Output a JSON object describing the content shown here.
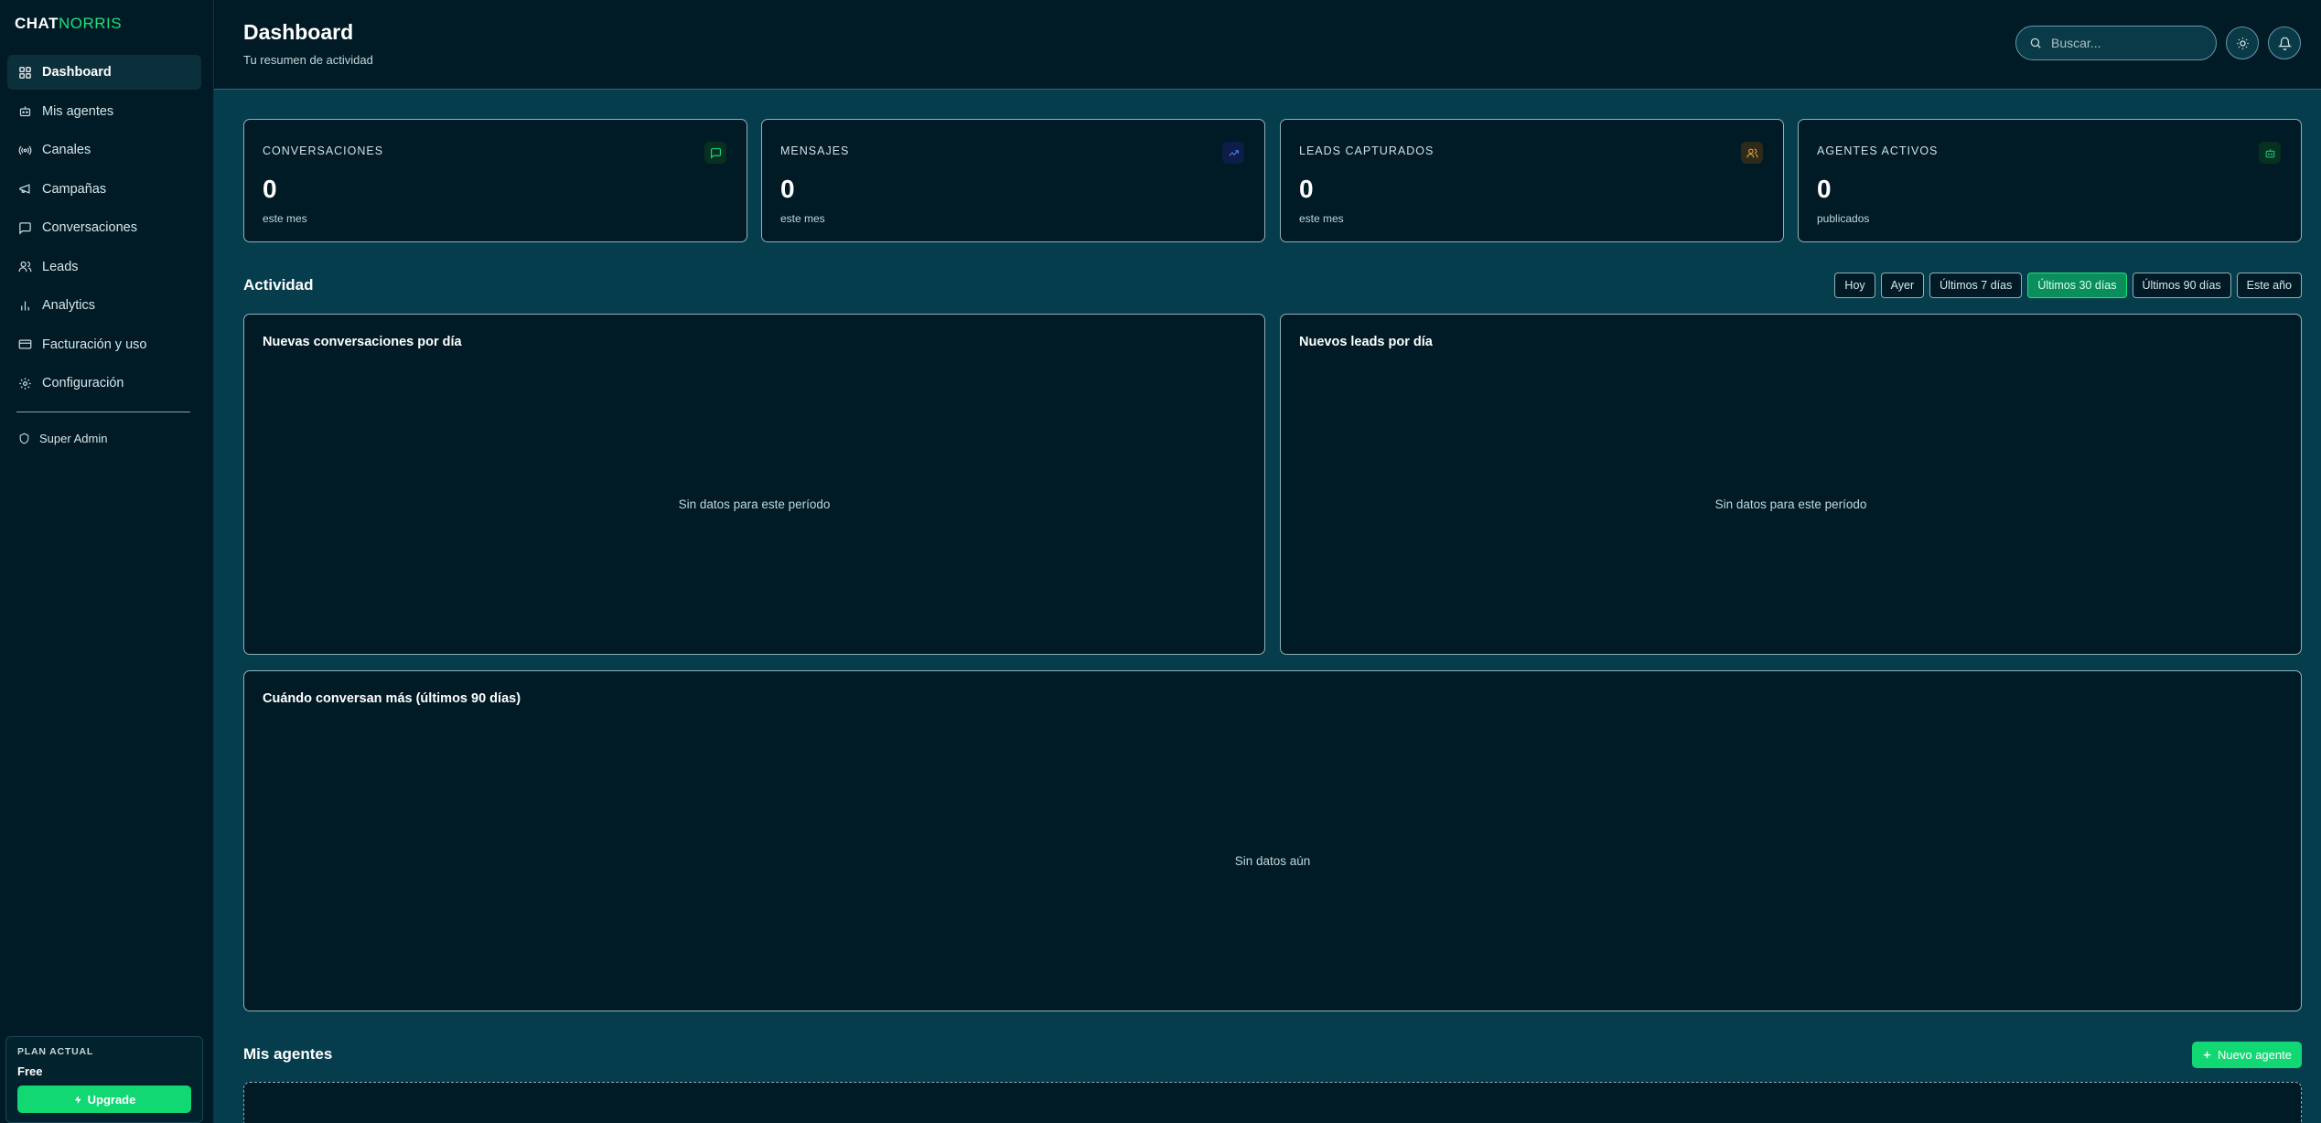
{
  "brand": {
    "part1": "CHAT",
    "part2": "NORRIS"
  },
  "sidebar": {
    "items": [
      {
        "label": "Dashboard",
        "icon": "grid-icon",
        "active": true
      },
      {
        "label": "Mis agentes",
        "icon": "bot-icon"
      },
      {
        "label": "Canales",
        "icon": "radio-icon"
      },
      {
        "label": "Campañas",
        "icon": "megaphone-icon"
      },
      {
        "label": "Conversaciones",
        "icon": "message-square-icon"
      },
      {
        "label": "Leads",
        "icon": "users-icon"
      },
      {
        "label": "Analytics",
        "icon": "bar-chart-icon"
      },
      {
        "label": "Facturación y uso",
        "icon": "credit-card-icon"
      },
      {
        "label": "Configuración",
        "icon": "gear-icon"
      }
    ],
    "super_admin": "Super Admin",
    "plan": {
      "label": "PLAN ACTUAL",
      "name": "Free",
      "upgrade": "Upgrade"
    }
  },
  "header": {
    "title": "Dashboard",
    "subtitle": "Tu resumen de actividad",
    "search_placeholder": "Buscar..."
  },
  "stats": [
    {
      "label": "CONVERSACIONES",
      "value": "0",
      "sub": "este mes",
      "icon": "message-square-icon",
      "color": "#19e37e"
    },
    {
      "label": "MENSAJES",
      "value": "0",
      "sub": "este mes",
      "icon": "trending-up-icon",
      "color": "#4f7bff"
    },
    {
      "label": "LEADS CAPTURADOS",
      "value": "0",
      "sub": "este mes",
      "icon": "users-icon",
      "color": "#e3a545"
    },
    {
      "label": "AGENTES ACTIVOS",
      "value": "0",
      "sub": "publicados",
      "icon": "bot-icon",
      "color": "#19c37e"
    }
  ],
  "activity": {
    "title": "Actividad",
    "periods": [
      "Hoy",
      "Ayer",
      "Últimos 7 días",
      "Últimos 30 días",
      "Últimos 90 días",
      "Este año"
    ],
    "active_period": "Últimos 30 días",
    "charts": [
      {
        "title": "Nuevas conversaciones por día",
        "empty": "Sin datos para este período"
      },
      {
        "title": "Nuevos leads por día",
        "empty": "Sin datos para este período"
      }
    ],
    "heatmap": {
      "title": "Cuándo conversan más (últimos 90 días)",
      "empty": "Sin datos aún"
    }
  },
  "agents": {
    "title": "Mis agentes",
    "new_button": "Nuevo agente"
  },
  "colors": {
    "accent": "#11d873",
    "background": "#063d4d",
    "panel": "#001b26"
  }
}
